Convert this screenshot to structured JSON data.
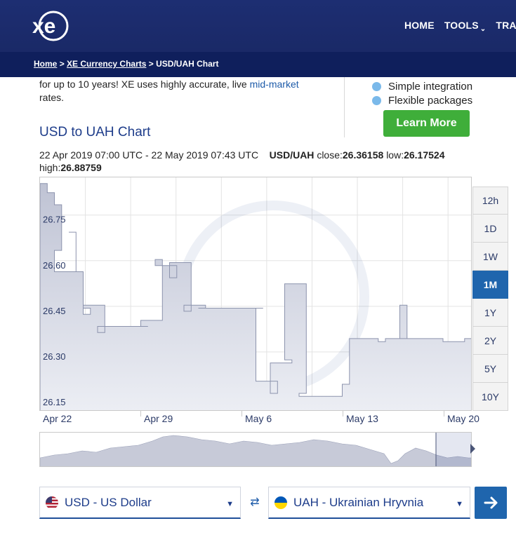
{
  "header": {
    "logo_text": "xe",
    "nav": [
      "HOME",
      "TOOLS",
      "TRAN"
    ]
  },
  "breadcrumb": {
    "home": "Home",
    "sep1": ">",
    "charts": "XE Currency Charts",
    "sep2": ">",
    "current": "USD/UAH Chart"
  },
  "intro": {
    "text_before": "for up to 10 years! XE uses highly accurate, live ",
    "link": "mid-market",
    "text_after": " rates."
  },
  "features": [
    "Simple integration",
    "Flexible packages"
  ],
  "learn_more": "Learn More",
  "chart_title": "USD to UAH Chart",
  "summary": {
    "range": "22 Apr 2019 07:00 UTC - 22 May 2019 07:43 UTC",
    "pair": "USD/UAH",
    "close_label": "close:",
    "close": "26.36158",
    "low_label": "low:",
    "low": "26.17524",
    "high_label": "high:",
    "high": "26.88759"
  },
  "range_buttons": [
    "12h",
    "1D",
    "1W",
    "1M",
    "1Y",
    "2Y",
    "5Y",
    "10Y"
  ],
  "active_range": "1M",
  "colors": {
    "accent": "#1f65ad",
    "header": "#1a2a6c",
    "green": "#3fae3a"
  },
  "converter": {
    "from": "USD - US Dollar",
    "to": "UAH - Ukrainian Hryvnia"
  },
  "chart_data": {
    "type": "area",
    "x": [
      "2019-04-22",
      "2019-04-22",
      "2019-04-23",
      "2019-04-23",
      "2019-04-23",
      "2019-04-24",
      "2019-04-24",
      "2019-04-24",
      "2019-04-25",
      "2019-04-25",
      "2019-04-25",
      "2019-04-26",
      "2019-04-26",
      "2019-04-27",
      "2019-04-28",
      "2019-04-29",
      "2019-04-29",
      "2019-04-30",
      "2019-04-30",
      "2019-05-01",
      "2019-05-01",
      "2019-05-02",
      "2019-05-02",
      "2019-05-03",
      "2019-05-03",
      "2019-05-04",
      "2019-05-06",
      "2019-05-07",
      "2019-05-07",
      "2019-05-08",
      "2019-05-08",
      "2019-05-09",
      "2019-05-09",
      "2019-05-10",
      "2019-05-10",
      "2019-05-11",
      "2019-05-13",
      "2019-05-13",
      "2019-05-14",
      "2019-05-15",
      "2019-05-16",
      "2019-05-17",
      "2019-05-17",
      "2019-05-18",
      "2019-05-20",
      "2019-05-21",
      "2019-05-22"
    ],
    "values": [
      26.87,
      26.84,
      26.8,
      26.65,
      26.58,
      26.71,
      26.71,
      26.58,
      26.44,
      26.46,
      26.47,
      26.38,
      26.4,
      26.4,
      26.4,
      26.4,
      26.42,
      26.62,
      26.6,
      26.56,
      26.61,
      26.45,
      26.47,
      26.46,
      26.46,
      26.46,
      26.46,
      26.46,
      26.22,
      26.18,
      26.28,
      26.29,
      26.54,
      26.18,
      26.17,
      26.17,
      26.21,
      26.36,
      26.36,
      26.35,
      26.36,
      26.47,
      26.36,
      26.36,
      26.35,
      26.36,
      26.36
    ],
    "ylim": [
      26.12,
      26.89
    ],
    "yticks": [
      "26.75",
      "26.60",
      "26.45",
      "26.30",
      "26.15"
    ],
    "xticks": [
      "Apr 22",
      "Apr 29",
      "May 6",
      "May 13",
      "May 20"
    ],
    "grid": true
  }
}
